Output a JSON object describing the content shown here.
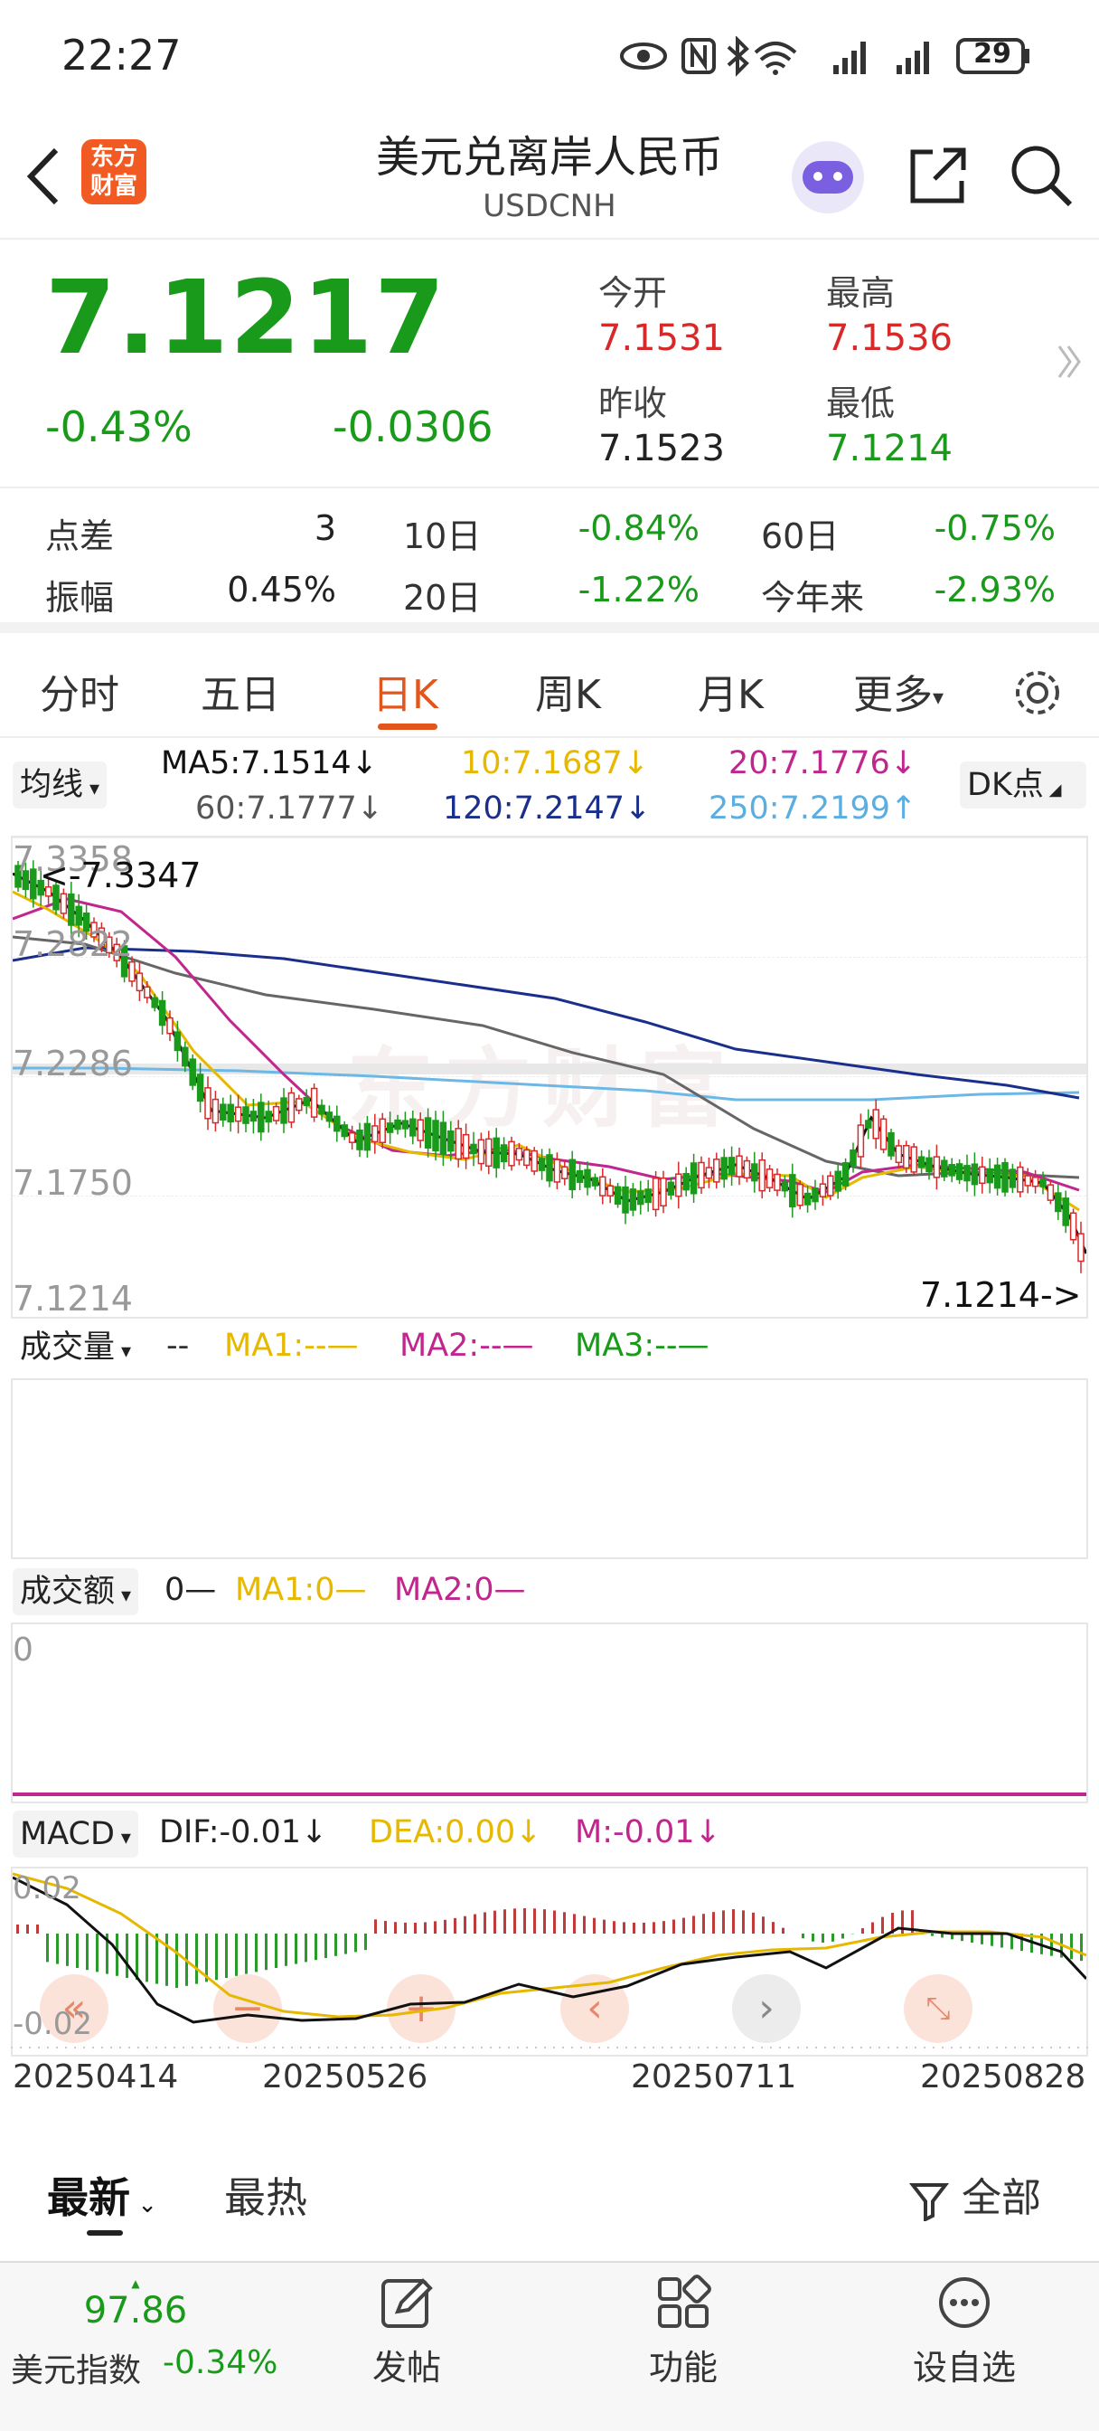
{
  "status": {
    "time": "22:27",
    "battery": "29"
  },
  "header": {
    "title": "美元兑离岸人民币",
    "code": "USDCNH",
    "logo": "东方\n财富"
  },
  "quote": {
    "price": "7.1217",
    "change_pct": "-0.43%",
    "change": "-0.0306",
    "open_label": "今开",
    "open": "7.1531",
    "high_label": "最高",
    "high": "7.1536",
    "prev_label": "昨收",
    "prev": "7.1523",
    "low_label": "最低",
    "low": "7.1214"
  },
  "stats": {
    "spread_label": "点差",
    "spread": "3",
    "amp_label": "振幅",
    "amp": "0.45%",
    "d10_label": "10日",
    "d10": "-0.84%",
    "d20_label": "20日",
    "d20": "-1.22%",
    "d60_label": "60日",
    "d60": "-0.75%",
    "ytd_label": "今年来",
    "ytd": "-2.93%"
  },
  "tabs": [
    "分时",
    "五日",
    "日K",
    "周K",
    "月K",
    "更多"
  ],
  "kline": {
    "ma_selector": "均线",
    "dk_button": "DK点",
    "ma5": "MA5:7.1514↓",
    "ma10": "10:7.1687↓",
    "ma20": "20:7.1776↓",
    "ma60": "60:7.1777↓",
    "ma120": "120:7.2147↓",
    "ma250": "250:7.2199↑",
    "y_labels": [
      "7.3358",
      "7.2822",
      "7.2286",
      "7.1750",
      "7.1214"
    ],
    "max_marker": "<-7.3347",
    "min_marker": "7.1214->",
    "watermark": "东方财富"
  },
  "volume": {
    "selector": "成交量",
    "value": "--",
    "ma1": "MA1:--—",
    "ma2": "MA2:--—",
    "ma3": "MA3:--—"
  },
  "turnover": {
    "selector": "成交额",
    "value": "0—",
    "ma1": "MA1:0—",
    "ma2": "MA2:0—",
    "zero": "0"
  },
  "macd": {
    "selector": "MACD",
    "dif": "DIF:-0.01↓",
    "dea": "DEA:0.00↓",
    "m": "M:-0.01↓",
    "y_top": "0.02",
    "y_bottom": "-0.02"
  },
  "x_dates": [
    "20250414",
    "20250526",
    "20250711",
    "20250828"
  ],
  "feed": {
    "latest": "最新",
    "hot": "最热",
    "all": "全部"
  },
  "bottom": {
    "index_value": "97.86",
    "index_name": "美元指数",
    "index_change": "-0.34%",
    "post": "发帖",
    "features": "功能",
    "watchlist": "设自选"
  },
  "colors": {
    "up": "#d62a2a",
    "down": "#1a9a1a",
    "accent": "#e2561d",
    "ma5": "#111111",
    "ma10": "#e6b800",
    "ma20": "#c0268e",
    "ma60": "#666666",
    "ma120": "#1a2f8c",
    "ma250": "#6bb8e6"
  }
}
